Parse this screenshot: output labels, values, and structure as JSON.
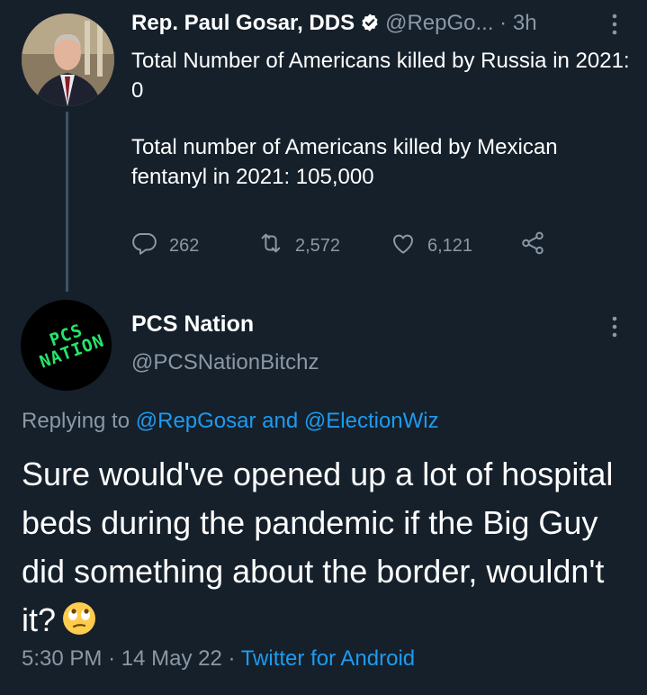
{
  "parent_tweet": {
    "author_name": "Rep. Paul Gosar, DDS",
    "handle": "@RepGo...",
    "separator": "·",
    "time": "3h",
    "paragraphs": [
      "Total Number of Americans killed by Russia in 2021:  0",
      "Total number of Americans killed by Mexican fentanyl in 2021: 105,000"
    ],
    "actions": {
      "replies": "262",
      "retweets": "2,572",
      "likes": "6,121"
    }
  },
  "reply_tweet": {
    "author_name": "PCS Nation",
    "handle": "@PCSNationBitchz",
    "avatar_text": "PCS NATION",
    "replying_prefix": "Replying to",
    "replying_user1": "@RepGosar",
    "replying_and": "and",
    "replying_user2": "@ElectionWiz",
    "text": "Sure would've opened up a lot of hospital beds during the pandemic if the Big Guy did something about the border, wouldn't it?",
    "emoji": "face-with-rolling-eyes",
    "time": "5:30 PM",
    "date": "14 May 22",
    "separator": "·",
    "source": "Twitter for Android"
  },
  "colors": {
    "background": "#15202b",
    "secondary_text": "#8b98a5",
    "link": "#1d9bf0",
    "verified": "#ffffff",
    "logo_green": "#27e36a"
  }
}
